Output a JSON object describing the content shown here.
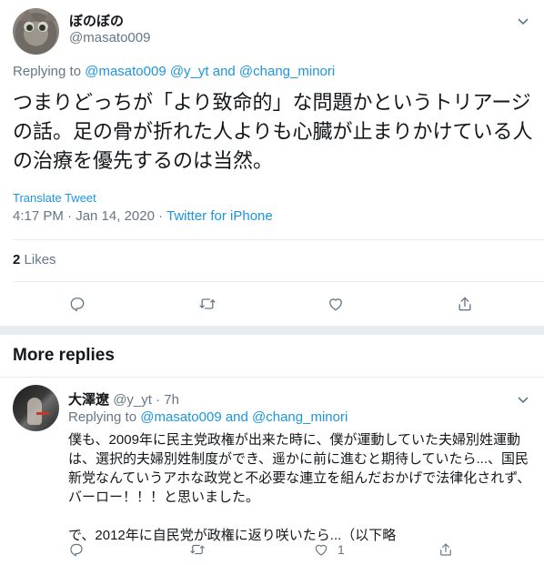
{
  "tweet": {
    "display_name": "ぼのぼの",
    "handle": "@masato009",
    "replying_label": "Replying to",
    "replying_to": "@masato009 @y_yt and @chang_minori",
    "text": "つまりどっちが「より致命的」な問題かというトリアージの話。足の骨が折れた人よりも心臓が止まりかけている人の治療を優先するのは当然。",
    "translate_label": "Translate Tweet",
    "timestamp": "4:17 PM · Jan 14, 2020",
    "separator": " · ",
    "source": "Twitter for iPhone",
    "likes_count": "2",
    "likes_label": "Likes"
  },
  "more_replies": {
    "heading": "More replies"
  },
  "reply": {
    "display_name": "大澤遼",
    "handle": "@y_yt",
    "time": " · 7h",
    "replying_label": "Replying to",
    "replying_to": "@masato009 and @chang_minori",
    "text_line1": "僕も、2009年に民主党政権が出来た時に、僕が運動していた夫婦別姓運動",
    "text_line2": "は、選択的夫婦別姓制度ができ、遥かに前に進むと期待していたら...、国民",
    "text_line3": "新党なんていうアホな政党と不必要な連立を組んだおかげで法律化されず、",
    "text_line4": "バーロー！！！と思いました。",
    "text_line5": "で、2012年に自民党が政権に返り咲いたら...（以下略",
    "like_count": "1"
  },
  "icons": {
    "reply": "reply-icon",
    "retweet": "retweet-icon",
    "like": "heart-icon",
    "share": "share-icon",
    "menu": "chevron-down-icon"
  },
  "colors": {
    "link": "#1b95e0",
    "secondary": "#657786",
    "text": "#14171a",
    "divider": "#e6ecf0"
  }
}
